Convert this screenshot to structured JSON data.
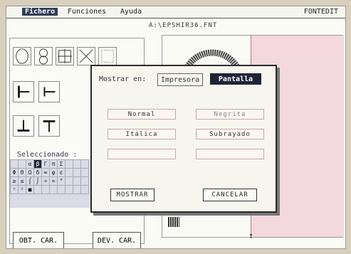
{
  "menu": {
    "items": [
      "Fichero",
      "Funciones",
      "Ayuda"
    ],
    "app_name": "FONTEDIT"
  },
  "file_path": "A:\\EPSHIR36.FNT",
  "left_panel": {
    "selected_label": "Seleccionado :",
    "charset_rows": [
      [
        "",
        "",
        "α",
        "β",
        "Γ",
        "π",
        "Σ",
        "",
        "",
        "",
        ""
      ],
      [
        "Φ",
        "Θ",
        "Ω",
        "δ",
        "∞",
        "φ",
        "ε",
        "",
        "",
        "",
        ""
      ],
      [
        "≥",
        "≤",
        "⌠",
        "⌡",
        "÷",
        "≈",
        "°",
        "",
        "",
        "",
        ""
      ],
      [
        "ⁿ",
        "²",
        "■",
        "",
        "",
        "",
        "",
        "",
        "",
        "",
        ""
      ]
    ],
    "obt_button": "OBT. CAR.",
    "dev_button": "DEV. CAR."
  },
  "dialog": {
    "mostrar_label": "Mostrar en:",
    "option_impresora": "Impresora",
    "option_pantalla": "Pantalla",
    "style_normal": "Normal",
    "style_negrita": "Negrita",
    "style_italica": "Itálica",
    "style_subrayado": "Subrayado",
    "mostrar_button": "MOSTRAR",
    "cancelar_button": "CANCELAR"
  },
  "arrow_glyph": "↑",
  "colors": {
    "menu_active": "#2f3d56",
    "pantalla_active": "#1f2435",
    "pink_area": "#f3d8de",
    "charset_bg": "#d9dbe6"
  }
}
